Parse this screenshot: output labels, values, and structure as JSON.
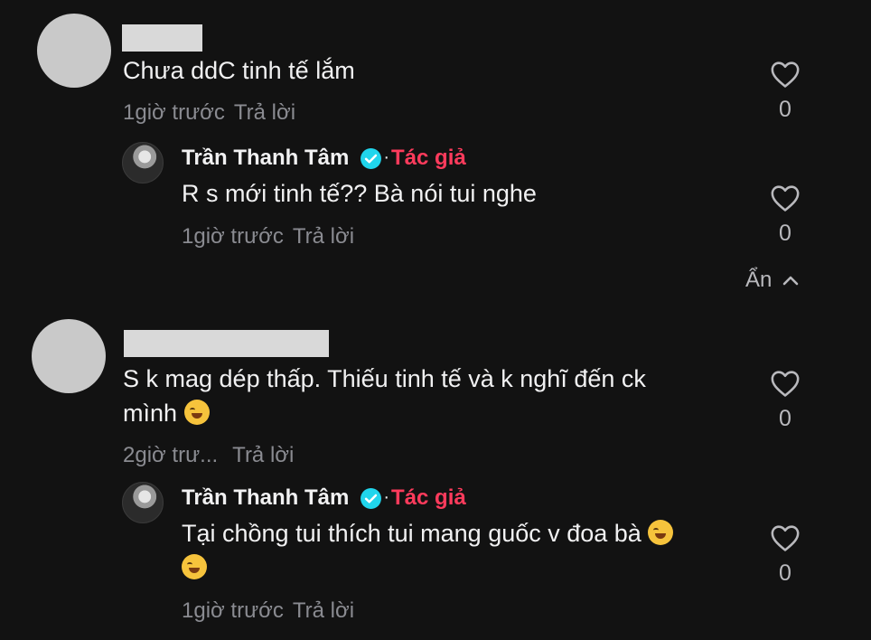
{
  "comments": [
    {
      "text": "Chưa ddC tinh tế lắm",
      "time": "1giờ trước",
      "reply_label": "Trả lời",
      "likes": "0",
      "reply": {
        "author": "Trần Thanh Tâm",
        "separator": "·",
        "author_tag": "Tác giả",
        "text": "R s mới tinh tế?? Bà nói tui nghe",
        "time": "1giờ trước",
        "reply_label": "Trả lời",
        "likes": "0"
      },
      "hide_label": "Ẩn"
    },
    {
      "text": "S k mag dép thấp. Thiếu tinh tế và k nghĩ đến ck",
      "text_line2": "mình",
      "time": "2giờ trư...",
      "reply_label": "Trả lời",
      "likes": "0",
      "reply": {
        "author": "Trần Thanh Tâm",
        "separator": "·",
        "author_tag": "Tác giả",
        "text": "Tại chồng tui thích tui mang guốc v đoa bà",
        "time": "1giờ trước",
        "reply_label": "Trả lời",
        "likes": "0"
      }
    }
  ],
  "icons": {
    "like": "heart-outline-icon",
    "verified": "verified-check-icon",
    "collapse": "chevron-up-icon",
    "emoji_1": "laughing-tears-emoji",
    "emoji_2": "rolling-laughing-emoji"
  },
  "colors": {
    "background": "#121212",
    "author_tag": "#ff3b5c",
    "verified": "#20d5ec",
    "meta_text": "#8a8b91"
  }
}
